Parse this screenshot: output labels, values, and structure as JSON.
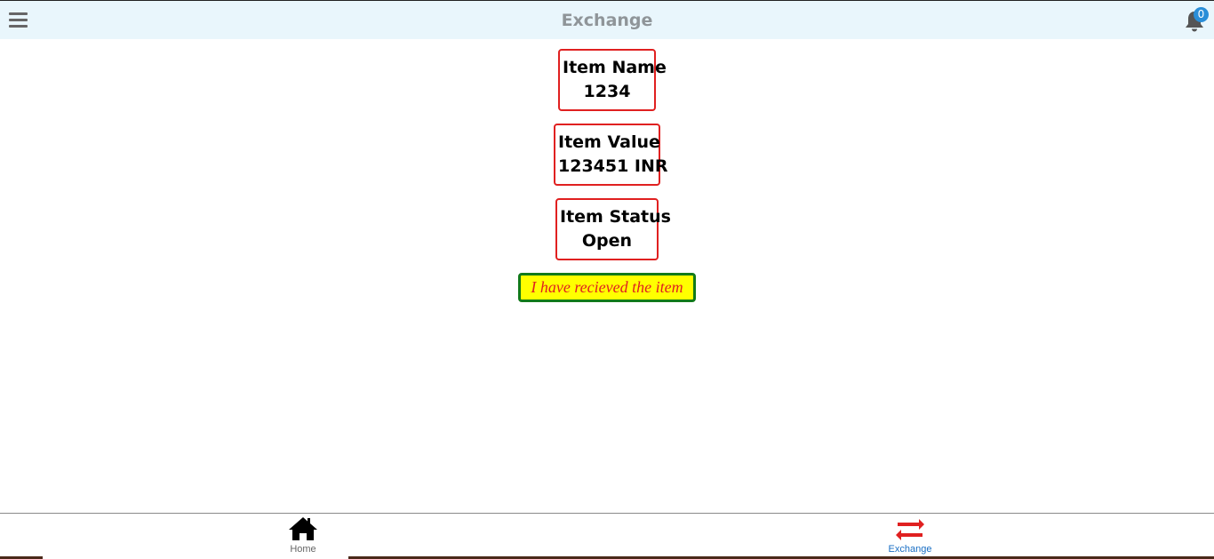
{
  "header": {
    "title": "Exchange",
    "notification_count": "0",
    "menu_icon": "hamburger-menu-icon",
    "bell_icon": "bell-icon"
  },
  "item": {
    "name_label": "Item Name",
    "name_value": "1234",
    "value_label": "Item Value",
    "value_value": "123451 INR",
    "status_label": "Item Status",
    "status_value": "Open"
  },
  "action": {
    "received_label": "I have recieved the item"
  },
  "footer": {
    "tabs": [
      {
        "label": "Home",
        "icon": "home-icon"
      },
      {
        "label": "Exchange",
        "icon": "exchange-arrows-icon",
        "active_color": "#e02020"
      }
    ]
  },
  "colors": {
    "header_bg": "#e9f6fc",
    "card_border": "#e02020",
    "button_bg": "#ffff00",
    "button_border": "#127a1a",
    "button_text": "#e02020",
    "badge": "#2a8ed8"
  }
}
